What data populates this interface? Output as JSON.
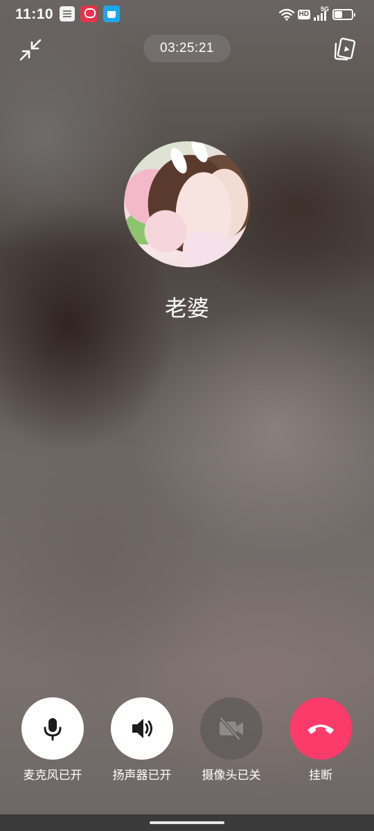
{
  "status_bar": {
    "time": "11:10",
    "hd": "HD",
    "network": "5G",
    "battery_level": 0.45,
    "notification_icons": [
      "notes-icon",
      "video-app-icon",
      "shopping-app-icon"
    ]
  },
  "call": {
    "duration": "03:25:21",
    "contact_name": "老婆",
    "avatar_icon": "contact-avatar"
  },
  "top_controls": {
    "minimize_icon": "minimize-icon",
    "switch_icon": "switch-to-voice-icon"
  },
  "controls": {
    "mic_label": "麦克风已开",
    "speaker_label": "扬声器已开",
    "camera_label": "摄像头已关",
    "hangup_label": "挂断"
  },
  "colors": {
    "hangup": "#fb3b6a",
    "button_on": "#ffffff",
    "button_off": "#605c5a"
  }
}
